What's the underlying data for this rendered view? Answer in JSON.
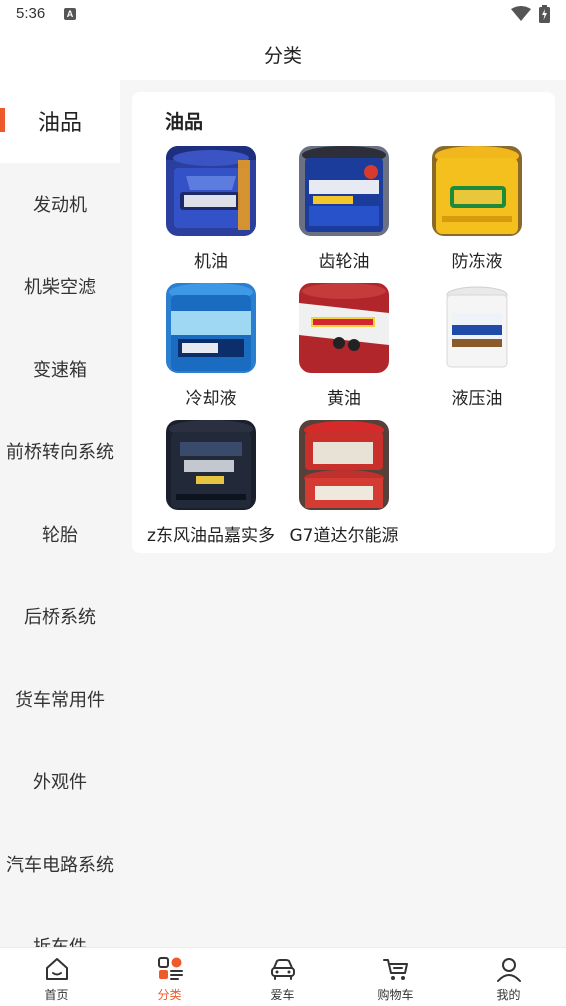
{
  "status_bar": {
    "time": "5:36",
    "notification_badge": "A"
  },
  "header": {
    "title": "分类"
  },
  "sidebar": {
    "items": [
      {
        "label": "油品",
        "active": true
      },
      {
        "label": "发动机"
      },
      {
        "label": "机柴空滤"
      },
      {
        "label": "变速箱"
      },
      {
        "label": "前桥转向系统"
      },
      {
        "label": "轮胎"
      },
      {
        "label": "后桥系统"
      },
      {
        "label": "货车常用件"
      },
      {
        "label": "外观件"
      },
      {
        "label": "汽车电路系统"
      },
      {
        "label": "拆车件"
      }
    ]
  },
  "category": {
    "title": "油品",
    "items": [
      {
        "label": "机油",
        "icon": "engine-oil-bucket"
      },
      {
        "label": "齿轮油",
        "icon": "gear-oil-bucket"
      },
      {
        "label": "防冻液",
        "icon": "antifreeze-bucket"
      },
      {
        "label": "冷却液",
        "icon": "coolant-bucket"
      },
      {
        "label": "黄油",
        "icon": "grease-bucket"
      },
      {
        "label": "液压油",
        "icon": "hydraulic-oil-bucket"
      },
      {
        "label": "z东风油品嘉实多",
        "icon": "ck4-oil-bucket"
      },
      {
        "label": "G7道达尔能源",
        "icon": "total-oil-bucket"
      }
    ]
  },
  "bottom_nav": {
    "items": [
      {
        "label": "首页",
        "icon": "home-icon"
      },
      {
        "label": "分类",
        "icon": "category-icon",
        "active": true
      },
      {
        "label": "爱车",
        "icon": "car-icon"
      },
      {
        "label": "购物车",
        "icon": "cart-icon"
      },
      {
        "label": "我的",
        "icon": "profile-icon"
      }
    ]
  },
  "colors": {
    "accent": "#ee5a2a",
    "sidebar_bg": "#f5f5f5",
    "content_bg": "#f6f6f6"
  }
}
